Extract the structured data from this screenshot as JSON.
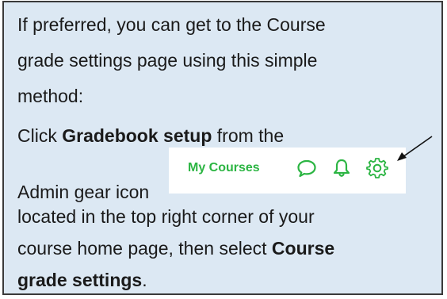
{
  "card": {
    "line1": "If preferred, you can get to the Course",
    "line2": "grade settings page using this simple",
    "line3": "method:",
    "click_prefix": "Click ",
    "gradebook_setup": "Gradebook setup",
    "click_suffix": " from the",
    "admin_gear": "Admin gear icon",
    "line6": "located in the top right corner of your",
    "line7_prefix": "course home page, then select ",
    "course_bold": "Course",
    "grade_settings_bold": "grade settings",
    "period": "."
  },
  "toolbar": {
    "my_courses": "My Courses",
    "accent_color": "#2cb543",
    "icons": [
      "chat-bubble-icon",
      "bell-icon",
      "gear-icon"
    ]
  },
  "colors": {
    "card_background": "#dce8f3",
    "card_border": "#3a3a3a"
  }
}
